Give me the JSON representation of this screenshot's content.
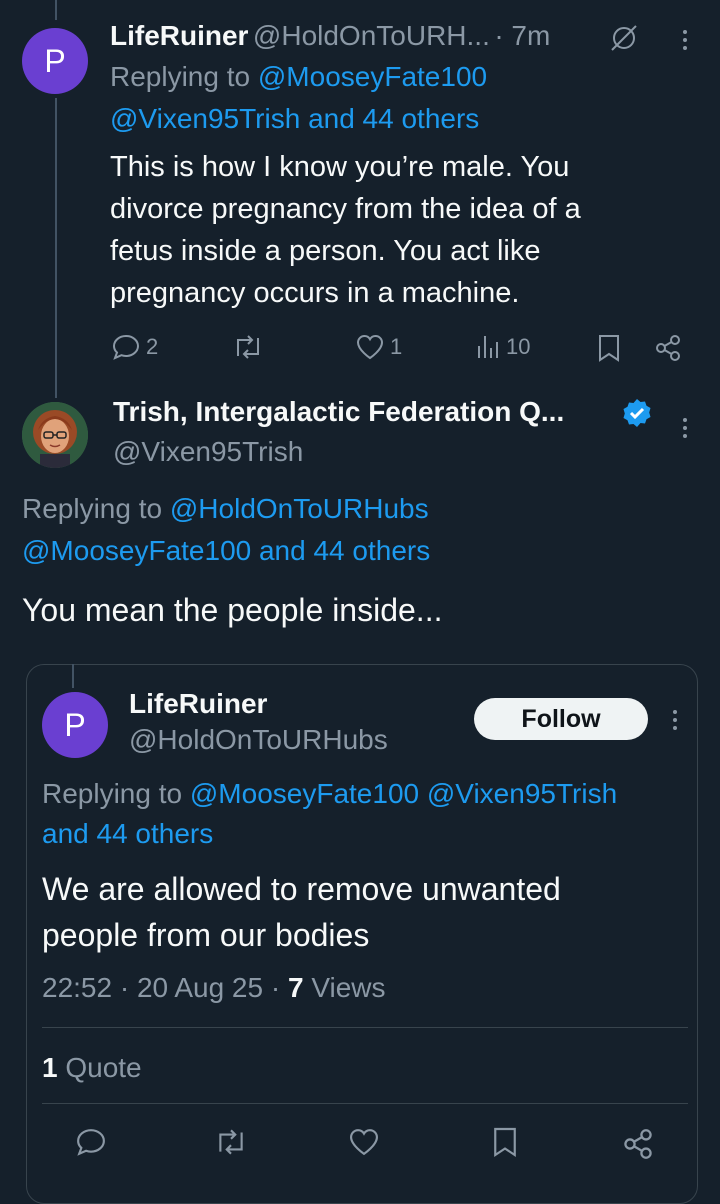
{
  "tweet1": {
    "avatar_letter": "P",
    "name": "LifeRuiner",
    "handle": "@HoldOnToURH...",
    "time": "· 7m",
    "replying_prefix": "Replying to",
    "replying_line1": "@MooseyFate100",
    "replying_line2": "@Vixen95Trish and 44 others",
    "text_lines": [
      "This is how I know you’re male. You",
      "divorce pregnancy from the idea of a",
      "fetus inside a person.  You act like",
      "pregnancy occurs in a machine."
    ],
    "replies": "2",
    "likes": "1",
    "views": "10"
  },
  "tweet2": {
    "name": "Trish, Intergalactic Federation Q...",
    "handle": "@Vixen95Trish",
    "replying_prefix": "Replying to",
    "replying_line1": "@HoldOnToURHubs",
    "replying_line2": "@MooseyFate100 and 44 others",
    "text": "You mean the people inside..."
  },
  "quoted": {
    "avatar_letter": "P",
    "name": "LifeRuiner",
    "handle": "@HoldOnToURHubs",
    "follow_label": "Follow",
    "replying_prefix": "Replying to",
    "replying_line1": "@MooseyFate100 @Vixen95Trish",
    "replying_line2": "and 44 others",
    "text_lines": [
      "We are allowed to remove unwanted",
      "people from our bodies"
    ],
    "timestamp": "22:52 · 20 Aug 25 · ",
    "views_count": "7",
    "views_label": " Views",
    "quote_count": "1",
    "quote_label": " Quote"
  },
  "colors": {
    "background": "#15202b",
    "accent": "#1d9bf0",
    "muted": "#8b98a5",
    "avatar": "#6a3fd1"
  }
}
